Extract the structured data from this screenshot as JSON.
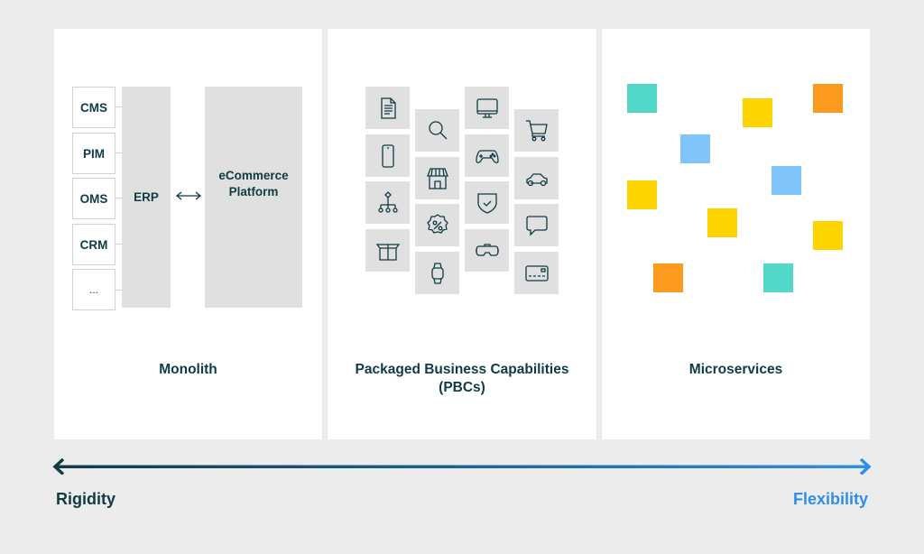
{
  "colors": {
    "background": "#ececec",
    "panel": "#ffffff",
    "tile": "#e0e0e0",
    "text_dark": "#0f3b45",
    "flex_blue": "#2f8fe6",
    "teal": "#52d8c8",
    "yellow": "#fdd400",
    "orange": "#fb9a1f",
    "blue": "#80c4fc"
  },
  "monolith": {
    "title": "Monolith",
    "systems": [
      "CMS",
      "PIM",
      "OMS",
      "CRM",
      "..."
    ],
    "erp_label": "ERP",
    "ecommerce_label_line1": "eCommerce",
    "ecommerce_label_line2": "Platform",
    "connector": "bidirectional-arrow"
  },
  "pbcs": {
    "title_line1": "Packaged Business Capabilities",
    "title_line2": "(PBCs)",
    "tiles": [
      [
        "document-icon",
        "smartphone-icon",
        "org-chart-icon",
        "box-icon"
      ],
      [
        "search-icon",
        "storefront-icon",
        "discount-icon",
        "smartwatch-icon"
      ],
      [
        "monitor-icon",
        "gamepad-icon",
        "shield-check-icon",
        "vr-headset-icon"
      ],
      [
        "cart-icon",
        "car-icon",
        "chat-bubble-icon",
        "credit-card-icon"
      ]
    ]
  },
  "microservices": {
    "title": "Microservices",
    "squares": [
      "teal",
      "yellow",
      "orange",
      "blue",
      "blue",
      "yellow",
      "yellow",
      "yellow",
      "orange",
      "teal"
    ]
  },
  "spectrum": {
    "left_label": "Rigidity",
    "right_label": "Flexibility"
  }
}
